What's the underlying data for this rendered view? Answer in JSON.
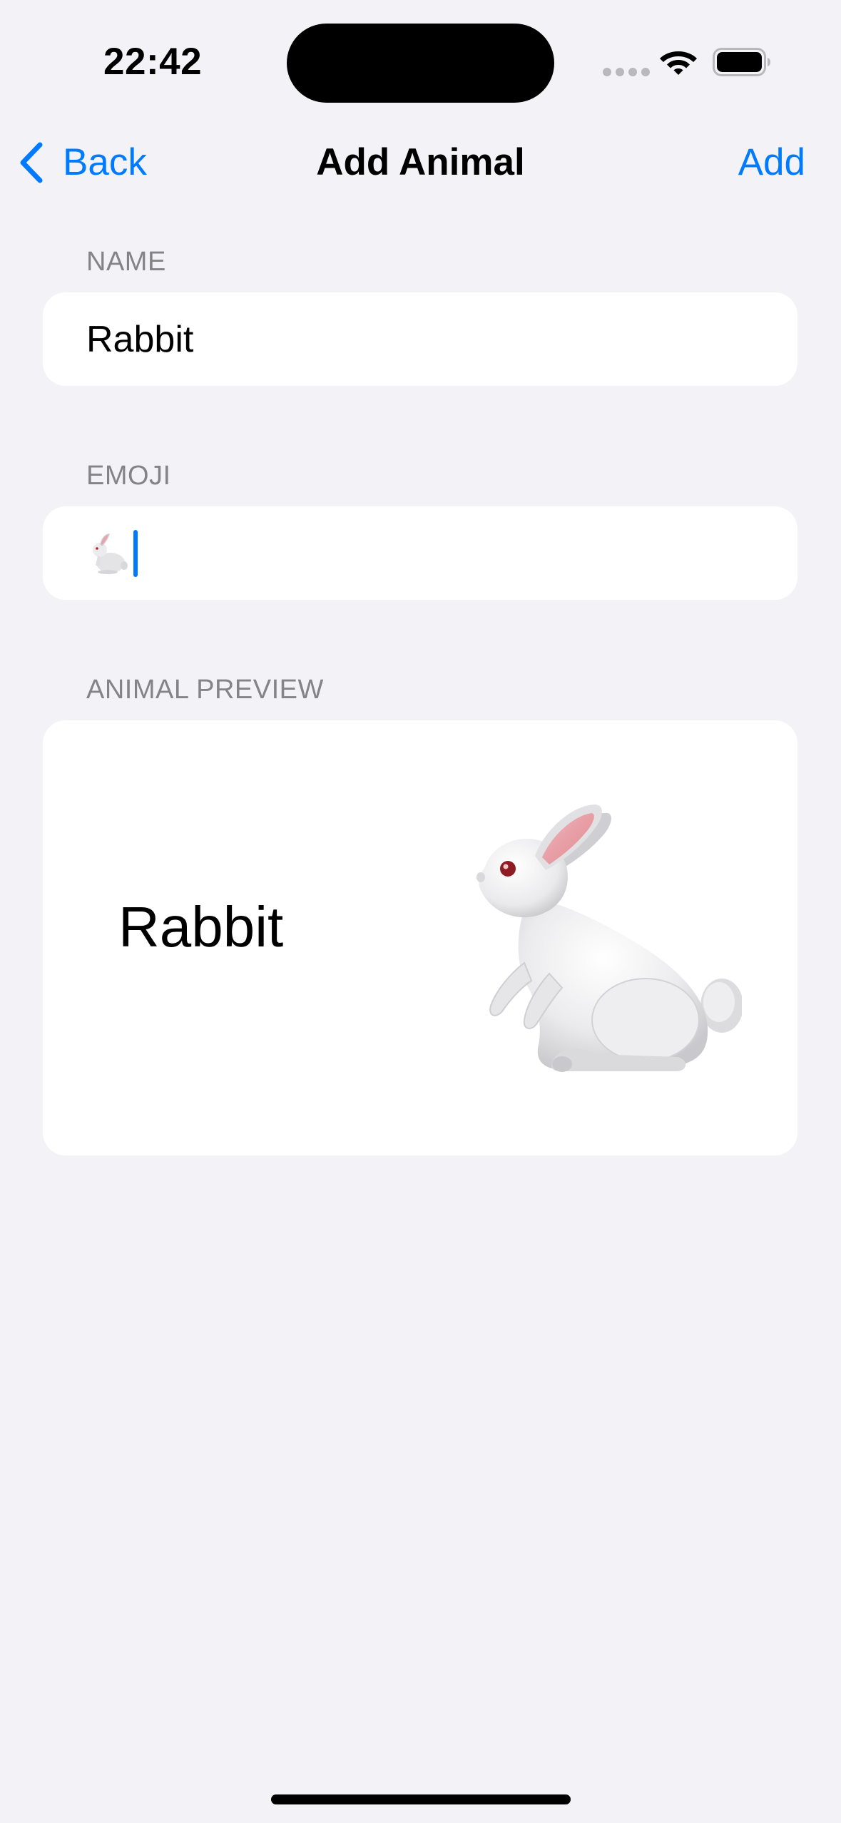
{
  "status_bar": {
    "time": "22:42",
    "icons": [
      "signal-dots-icon",
      "wifi-icon",
      "battery-icon"
    ]
  },
  "nav": {
    "back_label": "Back",
    "title": "Add Animal",
    "add_label": "Add"
  },
  "form": {
    "name_header": "NAME",
    "name_value": "Rabbit",
    "emoji_header": "EMOJI",
    "emoji_value": "🐇",
    "preview_header": "ANIMAL PREVIEW",
    "preview_name": "Rabbit",
    "preview_emoji": "rabbit-emoji-illustration"
  },
  "colors": {
    "background": "#f2f2f7",
    "card": "#ffffff",
    "accent": "#007aff",
    "secondary_text": "#838388"
  }
}
